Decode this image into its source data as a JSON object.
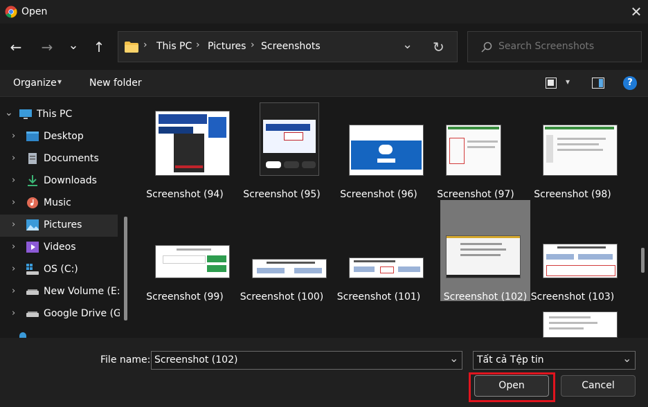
{
  "window": {
    "title": "Open",
    "close_glyph": "✕"
  },
  "nav": {
    "back_glyph": "←",
    "forward_glyph": "→",
    "recent_glyph": "⌄",
    "up_glyph": "↑",
    "breadcrumbs": [
      "This PC",
      "Pictures",
      "Screenshots"
    ],
    "separator": "›",
    "dropdown_glyph": "⌄",
    "refresh_glyph": "↻"
  },
  "search": {
    "placeholder": "Search Screenshots",
    "value": ""
  },
  "toolbar": {
    "organize_label": "Organize",
    "organize_caret": "▾",
    "new_folder_label": "New folder",
    "view_caret": "▾",
    "help_glyph": "?"
  },
  "sidebar": {
    "items": [
      {
        "label": "This PC",
        "icon": "monitor-icon"
      },
      {
        "label": "Desktop",
        "icon": "desktop-icon"
      },
      {
        "label": "Documents",
        "icon": "documents-icon"
      },
      {
        "label": "Downloads",
        "icon": "download-icon"
      },
      {
        "label": "Music",
        "icon": "music-icon"
      },
      {
        "label": "Pictures",
        "icon": "pictures-icon",
        "selected": true
      },
      {
        "label": "Videos",
        "icon": "videos-icon"
      },
      {
        "label": "OS (C:)",
        "icon": "os-drive-icon"
      },
      {
        "label": "New Volume (E:)",
        "icon": "drive-icon"
      },
      {
        "label": "Google Drive (G",
        "icon": "drive-icon"
      }
    ],
    "chevron": "›",
    "expanded_chevron": "⌄"
  },
  "files": [
    {
      "name": "Screenshot (94)"
    },
    {
      "name": "Screenshot (95)"
    },
    {
      "name": "Screenshot (96)"
    },
    {
      "name": "Screenshot (97)"
    },
    {
      "name": "Screenshot (98)"
    },
    {
      "name": "Screenshot (99)"
    },
    {
      "name": "Screenshot (100)"
    },
    {
      "name": "Screenshot (101)"
    },
    {
      "name": "Screenshot (102)",
      "selected": true
    },
    {
      "name": "Screenshot (103)"
    }
  ],
  "bottom": {
    "file_name_label": "File name:",
    "file_name_value": "Screenshot (102)",
    "file_type_value": "Tất cả Tệp tin",
    "dropdown_glyph": "⌄",
    "open_label": "Open",
    "cancel_label": "Cancel"
  },
  "colors": {
    "background": "#191919",
    "selection": "#777777",
    "highlight_box": "#e0141e",
    "help_blue": "#1e7ad6"
  }
}
